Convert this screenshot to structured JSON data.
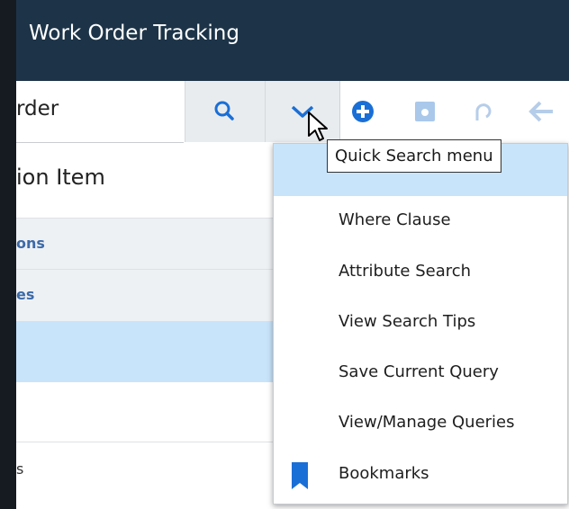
{
  "app": {
    "title": "Work Order Tracking"
  },
  "toolbar": {
    "search_value": "rder",
    "icons": [
      "search-icon",
      "chevron-down-icon",
      "add-circle-icon",
      "save-icon",
      "undo-icon",
      "back-arrow-icon"
    ]
  },
  "left_panel": {
    "heading": "ion Item",
    "rows": [
      {
        "label": "ons"
      },
      {
        "label": "es"
      },
      {
        "label": ""
      },
      {
        "label": ""
      },
      {
        "label": "s"
      }
    ]
  },
  "tooltip": {
    "text": "Quick Search menu"
  },
  "quick_search_menu": {
    "items": [
      {
        "label": "Where Clause"
      },
      {
        "label": "Attribute Search"
      },
      {
        "label": "View Search Tips"
      },
      {
        "label": "Save Current Query"
      },
      {
        "label": "View/Manage Queries"
      },
      {
        "label": "Bookmarks",
        "icon": "bookmark-icon"
      }
    ]
  },
  "colors": {
    "titlebar": "#1d3448",
    "accent_blue": "#1a6fd6",
    "menu_highlight": "#c8e4fb",
    "section_row_bg": "#eef1f4",
    "selected_row_bg": "#c8e4fb"
  }
}
